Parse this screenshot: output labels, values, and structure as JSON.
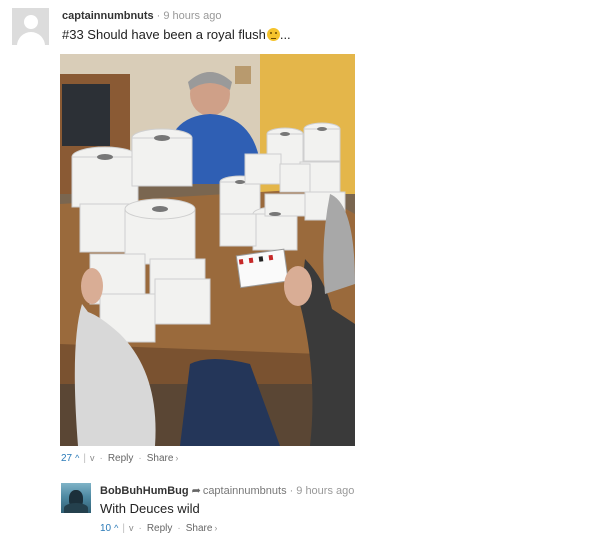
{
  "comment": {
    "username": "captainnumbnuts",
    "time": "9 hours ago",
    "text": "#33 Should have been a royal flush",
    "trailing": "...",
    "emoji": "unamused-face-emoji",
    "votes": "27",
    "reply_label": "Reply",
    "share_label": "Share"
  },
  "photo": {
    "subject": "men-playing-cards-with-toilet-paper-rolls-photo"
  },
  "reply": {
    "username": "BobBuhHumBug",
    "reply_to": "captainnumbnuts",
    "time": "9 hours ago",
    "text": "With Deuces wild",
    "votes": "10",
    "reply_label": "Reply",
    "share_label": "Share"
  },
  "colors": {
    "link_blue": "#2a7ab8",
    "meta_gray": "#999999"
  }
}
